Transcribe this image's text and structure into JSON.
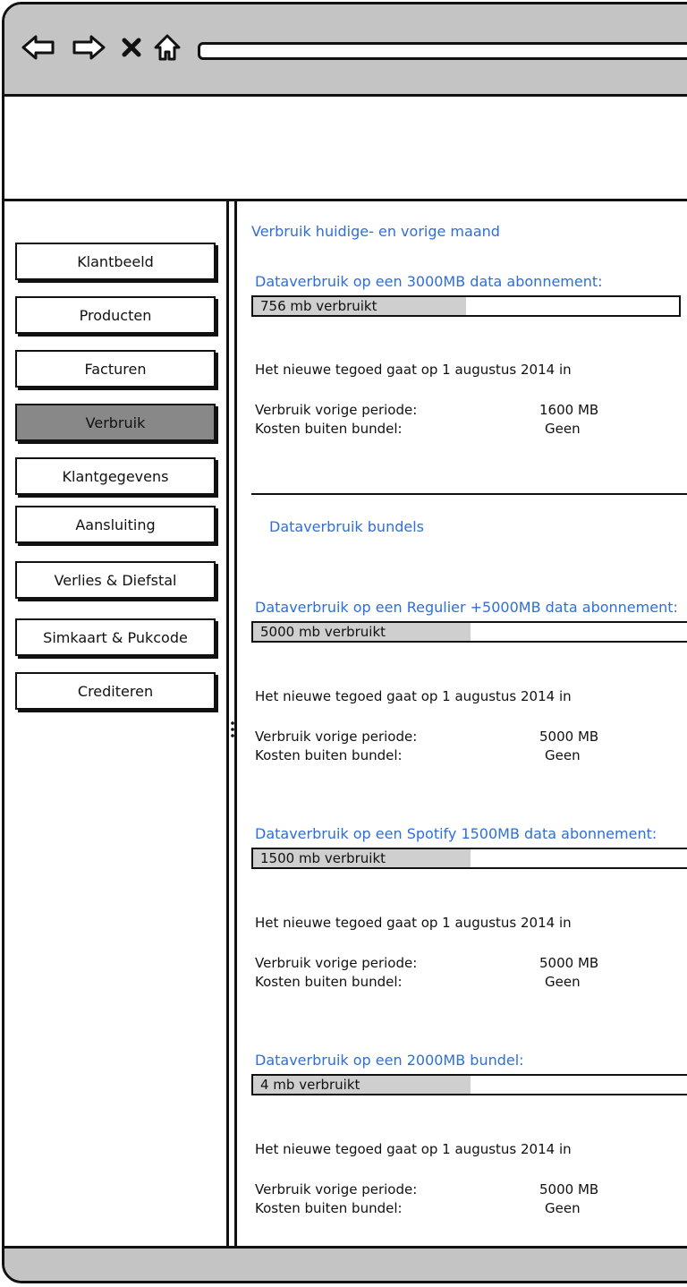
{
  "window": {
    "url": ""
  },
  "sidebar": {
    "items": [
      {
        "label": "Klantbeeld",
        "active": false
      },
      {
        "label": "Producten",
        "active": false
      },
      {
        "label": "Facturen",
        "active": false
      },
      {
        "label": "Verbruik",
        "active": true
      },
      {
        "label": "Klantgegevens",
        "active": false
      },
      {
        "label": "Aansluiting",
        "active": false
      },
      {
        "label": "Verlies & Diefstal",
        "active": false
      },
      {
        "label": "Simkaart & Pukcode",
        "active": false
      },
      {
        "label": "Crediteren",
        "active": false
      }
    ]
  },
  "main": {
    "heading": "Verbruik huidige- en vorige maand",
    "bundles_heading": "Dataverbruik bundels",
    "sections": [
      {
        "title": "Dataverbruik op een 3000MB data abonnement:",
        "bar_label": "756 mb verbruikt",
        "bar_fill_fraction": 0.5,
        "renewal": "Het nieuwe tegoed gaat op 1 augustus 2014 in",
        "prev_label": "Verbruik vorige periode:",
        "prev_value": "1600 MB",
        "cost_label": "Kosten buiten bundel:",
        "cost_value": "Geen"
      },
      {
        "title": "Dataverbruik op een Regulier +5000MB data abonnement:",
        "bar_label": "5000 mb verbruikt",
        "bar_fill_fraction": 0.5,
        "renewal": "Het nieuwe tegoed gaat op 1 augustus 2014 in",
        "prev_label": "Verbruik vorige periode:",
        "prev_value": "5000 MB",
        "cost_label": "Kosten buiten bundel:",
        "cost_value": "Geen"
      },
      {
        "title": "Dataverbruik op een Spotify 1500MB data abonnement:",
        "bar_label": "1500 mb verbruikt",
        "bar_fill_fraction": 0.5,
        "renewal": "Het nieuwe tegoed gaat op 1 augustus 2014 in",
        "prev_label": "Verbruik vorige periode:",
        "prev_value": "5000 MB",
        "cost_label": "Kosten buiten bundel:",
        "cost_value": "Geen"
      },
      {
        "title": "Dataverbruik op een 2000MB bundel:",
        "bar_label": "4 mb verbruikt",
        "bar_fill_fraction": 0.5,
        "renewal": "Het nieuwe tegoed gaat op 1 augustus 2014 in",
        "prev_label": "Verbruik vorige periode:",
        "prev_value": "5000 MB",
        "cost_label": "Kosten buiten bundel:",
        "cost_value": "Geen"
      }
    ]
  },
  "colors": {
    "accent": "#2f6fd6",
    "chrome": "#c4c4c4",
    "active_nav": "#888888",
    "bar_fill": "#cfcfcf"
  }
}
